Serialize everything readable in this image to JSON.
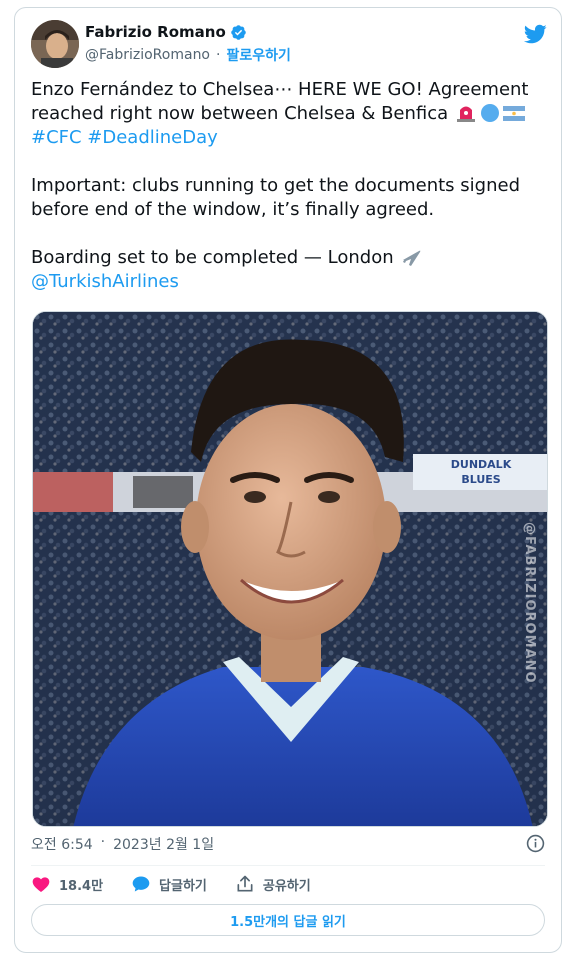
{
  "author": {
    "name": "Fabrizio Romano",
    "handle": "@FabrizioRomano",
    "follow_label": "팔로우하기"
  },
  "tweet": {
    "line1": "Enzo Fernández to Chelsea⋯ HERE WE GO! Agreement",
    "line2": "reached right now between Chelsea & Benfica",
    "hashtags": "#CFC #DeadlineDay",
    "para2": "Important: clubs running to get the documents signed\nbefore end of the window, it’s finally agreed.",
    "para3_text": "Boarding set to be completed — London",
    "mention": "@TurkishAirlines"
  },
  "media": {
    "watermark": "@FABRIZIOROMANO",
    "banner_text": "DUNDALK\nBLUES"
  },
  "meta": {
    "time": "오전 6:54",
    "separator": "·",
    "date": "2023년 2월 1일"
  },
  "actions": {
    "likes": "18.4만",
    "reply_label": "답글하기",
    "share_label": "공유하기"
  },
  "replies_button": "1.5만개의 답글 읽기",
  "colors": {
    "accent": "#1d9bf0",
    "like": "#f91880",
    "secondary_text": "#536471",
    "border": "#cfd9de"
  },
  "icons": [
    "verified-badge-icon",
    "twitter-bird-icon",
    "siren-icon",
    "blue-circle-icon",
    "argentina-flag-icon",
    "airplane-icon",
    "info-icon",
    "heart-icon",
    "reply-bubble-icon",
    "share-icon"
  ]
}
